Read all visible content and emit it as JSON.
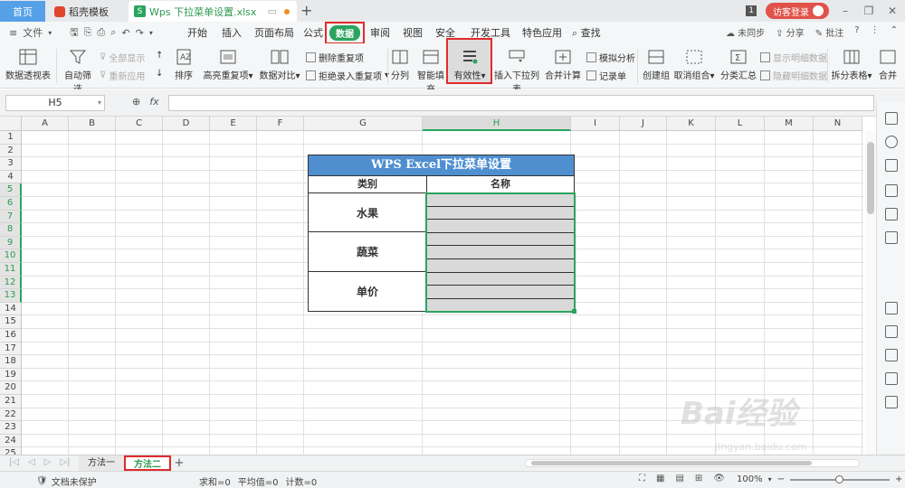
{
  "titlebar": {
    "home_tab": "首页",
    "template_tab": "稻壳模板",
    "file_tab": "Wps  下拉菜单设置.xlsx",
    "new_tab": "+",
    "badge": "1",
    "login": "访客登录"
  },
  "menubar": {
    "file_menu": "文件",
    "items": [
      "开始",
      "插入",
      "页面布局",
      "公式",
      "数据",
      "审阅",
      "视图",
      "安全",
      "开发工具",
      "特色应用",
      "查找"
    ],
    "right": [
      "未同步",
      "分享",
      "批注",
      "?"
    ]
  },
  "ribbon": {
    "pivot": "数据透视表",
    "autofilter": "自动筛选",
    "show_all": "全部显示",
    "reapply": "重新应用",
    "sort": "排序",
    "highlight_dup": "高亮重复项",
    "data_compare": "数据对比",
    "remove_dup": "删除重复项",
    "reject_dup": "拒绝录入重复项",
    "split_col": "分列",
    "smart_fill": "智能填充",
    "validity": "有效性",
    "insert_dropdown": "插入下拉列表",
    "merge_calc": "合并计算",
    "simulate": "模拟分析",
    "record": "记录单",
    "create_group": "创建组",
    "ungroup": "取消组合",
    "subtotal": "分类汇总",
    "show_detail": "显示明细数据",
    "hide_detail": "隐藏明细数据",
    "split_table": "拆分表格",
    "merge": "合并"
  },
  "formulabar": {
    "cell_ref": "H5",
    "fx": "fx",
    "content": ""
  },
  "grid": {
    "columns": [
      "A",
      "B",
      "C",
      "D",
      "E",
      "F",
      "G",
      "H",
      "I",
      "J",
      "K",
      "L",
      "M",
      "N"
    ],
    "selected_column": "H",
    "rows": [
      "1",
      "2",
      "3",
      "4",
      "5",
      "6",
      "7",
      "8",
      "9",
      "10",
      "11",
      "12",
      "13",
      "14",
      "15",
      "16",
      "17",
      "18",
      "19",
      "20",
      "21",
      "22",
      "23",
      "24",
      "25"
    ],
    "selected_rows": [
      "5",
      "6",
      "7",
      "8",
      "9",
      "10",
      "11",
      "12",
      "13"
    ]
  },
  "table": {
    "title": "WPS Excel下拉菜单设置",
    "header_category": "类别",
    "header_name": "名称",
    "categories": [
      "水果",
      "蔬菜",
      "单价"
    ]
  },
  "sheets": {
    "tabs": [
      "方法一",
      "方法二"
    ],
    "active": "方法二",
    "add": "+"
  },
  "statusbar": {
    "protect": "文档未保护",
    "sum": "求和=0",
    "avg": "平均值=0",
    "count": "计数=0",
    "zoom": "100%",
    "zoom_level_percent": 100
  },
  "watermark": {
    "text": "Bai经验",
    "url": "jingyan.baidu.com"
  },
  "colors": {
    "accent_green": "#2aa45e",
    "title_blue": "#4f8fd0",
    "highlight_red": "#e02b2b"
  }
}
